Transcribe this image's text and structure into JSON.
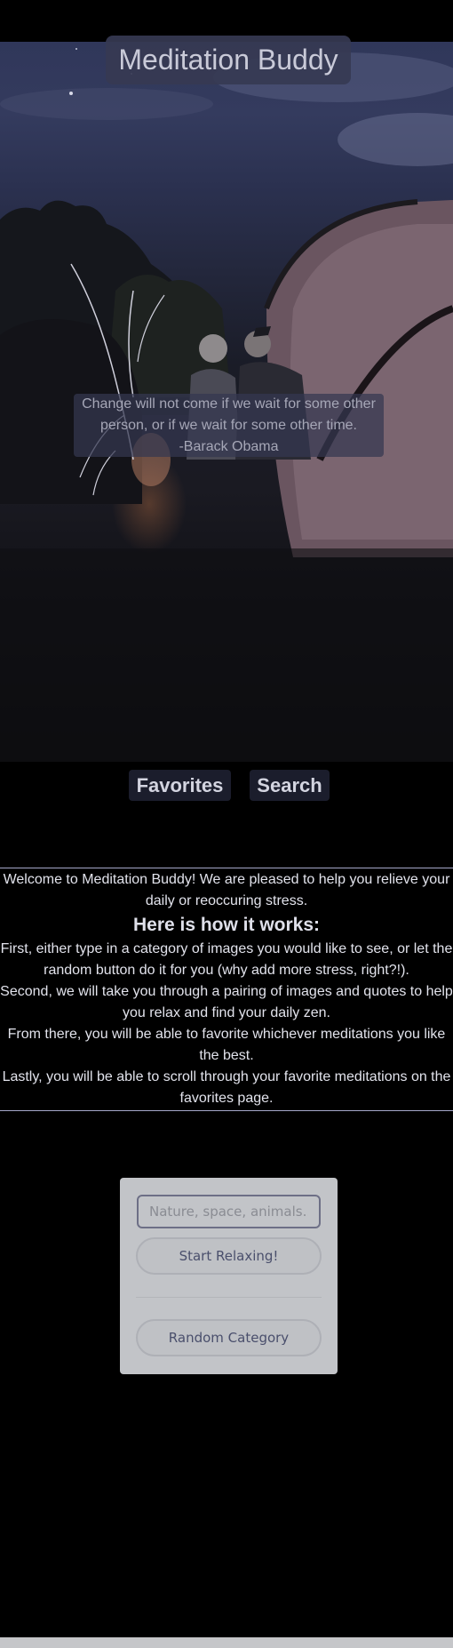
{
  "app": {
    "title": "Meditation Buddy"
  },
  "quote": {
    "text": "Change will not come if we wait for some other person, or if we wait for some other time.",
    "author": "-Barack Obama"
  },
  "nav": {
    "favorites_label": "Favorites",
    "search_label": "Search"
  },
  "intro": {
    "welcome": "Welcome to Meditation Buddy! We are pleased to help you relieve your daily or reoccuring stress.",
    "heading": "Here is how it works:",
    "steps": [
      "First, either type in a category of images you would like to see, or let the random button do it for you (why add more stress, right?!).",
      "Second, we will take you through a pairing of images and quotes to help you relax and find your daily zen.",
      "From there, you will be able to favorite whichever meditations you like the best.",
      "Lastly, you will be able to scroll through your favorite meditations on the favorites page."
    ]
  },
  "search": {
    "placeholder": "Nature, space, animals...",
    "value": "",
    "start_label": "Start Relaxing!",
    "random_label": "Random Category"
  },
  "colors": {
    "accent": "#a5a7c8",
    "card": "#c2c4c8",
    "button_text": "#4a4f6c"
  }
}
